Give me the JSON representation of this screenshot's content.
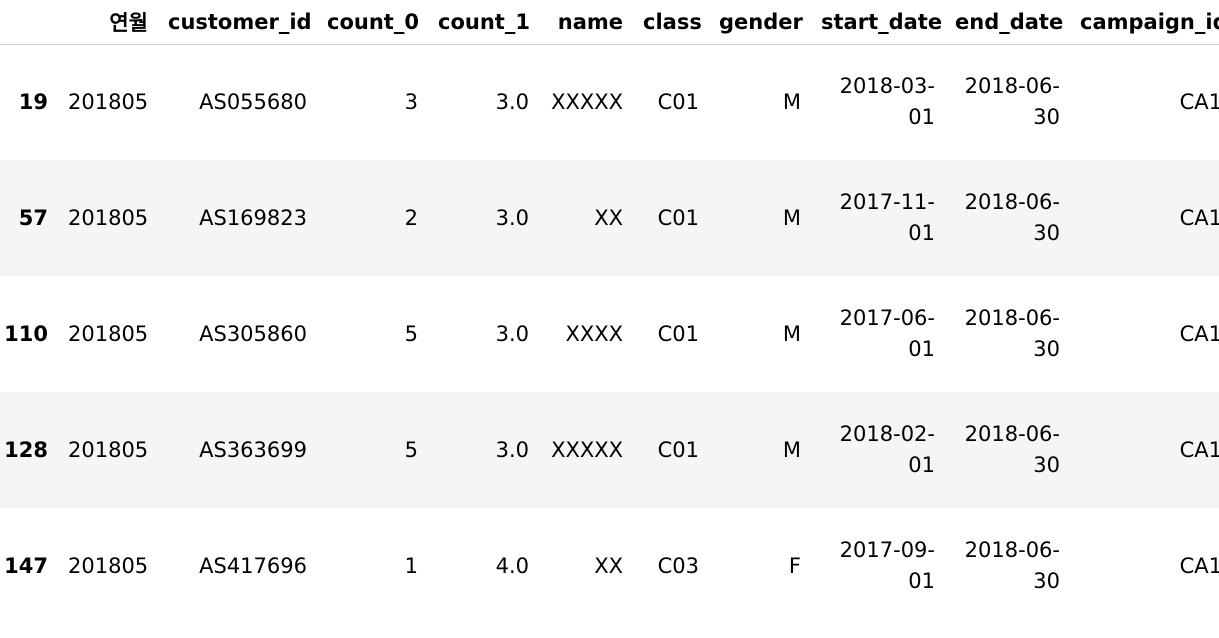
{
  "table": {
    "columns": [
      "연월",
      "customer_id",
      "count_0",
      "count_1",
      "name",
      "class",
      "gender",
      "start_date",
      "end_date",
      "campaign_id"
    ],
    "rows": [
      {
        "index": "19",
        "ym": "201805",
        "customer_id": "AS055680",
        "count_0": "3",
        "count_1": "3.0",
        "name": "XXXXX",
        "class": "C01",
        "gender": "M",
        "start_date_1": "2018-03-",
        "start_date_2": "01",
        "end_date_1": "2018-06-",
        "end_date_2": "30",
        "campaign_id": "CA1"
      },
      {
        "index": "57",
        "ym": "201805",
        "customer_id": "AS169823",
        "count_0": "2",
        "count_1": "3.0",
        "name": "XX",
        "class": "C01",
        "gender": "M",
        "start_date_1": "2017-11-",
        "start_date_2": "01",
        "end_date_1": "2018-06-",
        "end_date_2": "30",
        "campaign_id": "CA1"
      },
      {
        "index": "110",
        "ym": "201805",
        "customer_id": "AS305860",
        "count_0": "5",
        "count_1": "3.0",
        "name": "XXXX",
        "class": "C01",
        "gender": "M",
        "start_date_1": "2017-06-",
        "start_date_2": "01",
        "end_date_1": "2018-06-",
        "end_date_2": "30",
        "campaign_id": "CA1"
      },
      {
        "index": "128",
        "ym": "201805",
        "customer_id": "AS363699",
        "count_0": "5",
        "count_1": "3.0",
        "name": "XXXXX",
        "class": "C01",
        "gender": "M",
        "start_date_1": "2018-02-",
        "start_date_2": "01",
        "end_date_1": "2018-06-",
        "end_date_2": "30",
        "campaign_id": "CA1"
      },
      {
        "index": "147",
        "ym": "201805",
        "customer_id": "AS417696",
        "count_0": "1",
        "count_1": "4.0",
        "name": "XX",
        "class": "C03",
        "gender": "F",
        "start_date_1": "2017-09-",
        "start_date_2": "01",
        "end_date_1": "2018-06-",
        "end_date_2": "30",
        "campaign_id": "CA1"
      }
    ]
  },
  "colors": {
    "row_stripe": "#f5f5f5",
    "header_border": "#cfcfcf",
    "text": "#000000"
  }
}
